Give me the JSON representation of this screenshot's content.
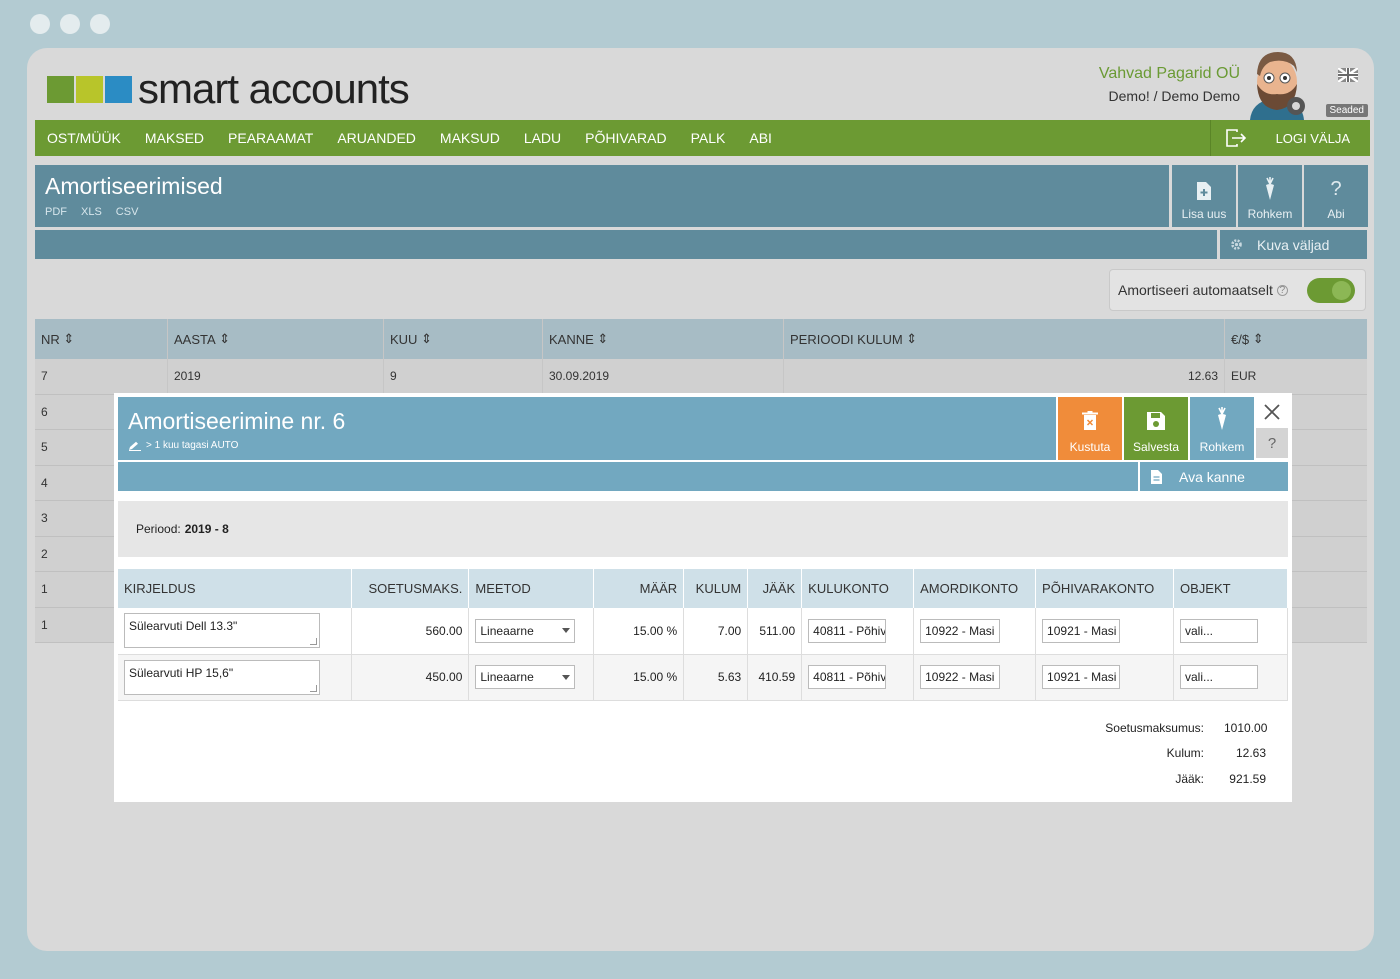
{
  "brand": {
    "name": "smart accounts",
    "colors": [
      "#6c9a33",
      "#b8c52a",
      "#2b8cc4"
    ]
  },
  "company": {
    "name": "Vahvad Pagarid OÜ",
    "user": "Demo! / Demo Demo",
    "settings_label": "Seaded"
  },
  "nav": {
    "items": [
      "OST/MÜÜK",
      "MAKSED",
      "PEARAAMAT",
      "ARUANDED",
      "MAKSUD",
      "LADU",
      "PÕHIVARAD",
      "PALK",
      "ABI"
    ],
    "logout": "LOGI VÄLJA"
  },
  "page": {
    "title": "Amortiseerimised",
    "exports": [
      "PDF",
      "XLS",
      "CSV"
    ],
    "buttons": {
      "add": "Lisa uus",
      "more": "Rohkem",
      "help": "Abi"
    },
    "show_fields": "Kuva väljad",
    "auto_label": "Amortiseeri automaatselt"
  },
  "bg_table": {
    "headers": [
      "NR",
      "AASTA",
      "KUU",
      "KANNE",
      "PERIOODI KULUM",
      "€/$"
    ],
    "row7": {
      "nr": "7",
      "year": "2019",
      "month": "9",
      "entry": "30.09.2019",
      "amount": "12.63",
      "currency": "EUR"
    },
    "nrs": [
      "6",
      "5",
      "4",
      "3",
      "2",
      "1",
      "1"
    ]
  },
  "modal": {
    "title": "Amortiseerimine nr. 6",
    "subtitle": "> 1 kuu tagasi AUTO",
    "buttons": {
      "delete": "Kustuta",
      "save": "Salvesta",
      "more": "Rohkem",
      "help": "?"
    },
    "open_entry": "Ava kanne",
    "period_label": "Periood:",
    "period_value": "2019 - 8",
    "headers": [
      "KIRJELDUS",
      "SOETUSMAKS.",
      "MEETOD",
      "MÄÄR",
      "KULUM",
      "JÄÄK",
      "KULUKONTO",
      "AMORDIKONTO",
      "PÕHIVARAKONTO",
      "OBJEKT"
    ],
    "rows": [
      {
        "desc": "Sülearvuti Dell 13.3\"",
        "cost": "560.00",
        "method": "Lineaarne",
        "rate": "15.00 %",
        "dep": "7.00",
        "rest": "511.00",
        "exp": "40811 - Põhiv",
        "amort": "10922 - Masi",
        "asset": "10921 - Masi",
        "obj": "vali..."
      },
      {
        "desc": "Sülearvuti HP 15,6\"",
        "cost": "450.00",
        "method": "Lineaarne",
        "rate": "15.00 %",
        "dep": "5.63",
        "rest": "410.59",
        "exp": "40811 - Põhiv",
        "amort": "10922 - Masi",
        "asset": "10921 - Masi",
        "obj": "vali..."
      }
    ],
    "totals": [
      {
        "label": "Soetusmaksumus:",
        "value": "1010.00"
      },
      {
        "label": "Kulum:",
        "value": "12.63"
      },
      {
        "label": "Jääk:",
        "value": "921.59"
      }
    ]
  }
}
